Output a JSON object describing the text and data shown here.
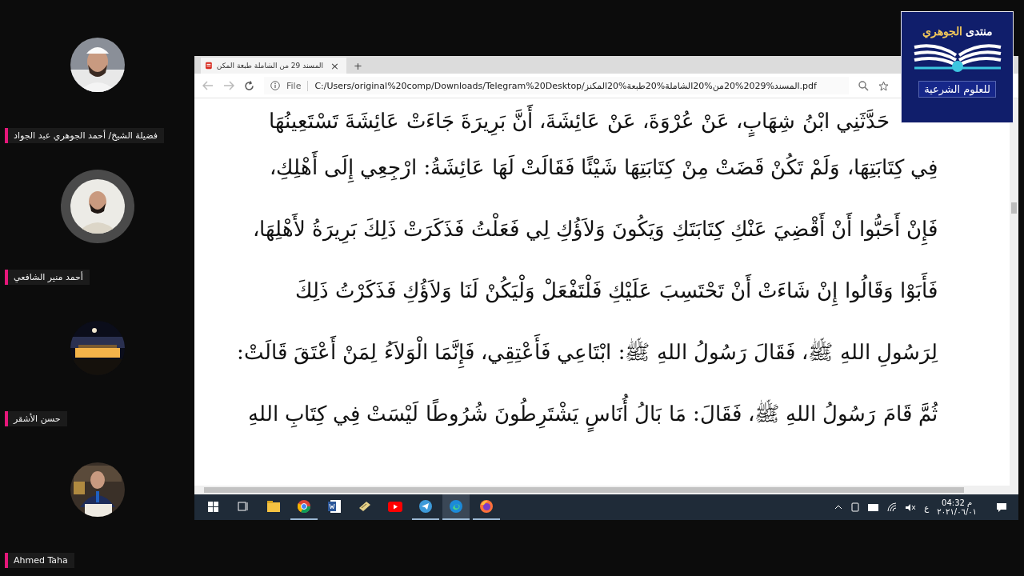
{
  "participants": [
    {
      "name": "فضيلة الشيخ/ أحمد الجوهري عبد الجواد",
      "speaking": false
    },
    {
      "name": "أحمد منير الشافعي",
      "speaking": true
    },
    {
      "name": "حسن الأشقر",
      "speaking": false
    },
    {
      "name": "Ahmed Taha",
      "speaking": false
    }
  ],
  "logo": {
    "title_start": "منتدى",
    "title_name": "الجوهري",
    "subtitle": "للعلوم الشرعية"
  },
  "browser": {
    "tab": {
      "title": "المسند 29 من الشاملة طبعة المكن",
      "close": "×"
    },
    "new_tab": "+",
    "address": {
      "scheme_label": "File",
      "url": "C:/Users/original%20comp/Downloads/Telegram%20Desktop/المسند%2029%20من%20الشاملة%20طبعة%20المكنز.pdf"
    }
  },
  "document": {
    "lines": [
      "حَدَّثَنِي ابْنُ شِهَابٍ، عَنْ عُرْوَةَ، عَنْ عَائِشَةَ، أَنَّ بَرِيرَةَ جَاءَتْ عَائِشَةَ تَسْتَعِينُهَا",
      "فِي كِتَابَتِهَا، وَلَمْ تَكُنْ قَضَتْ مِنْ كِتَابَتِهَا شَيْئًا فَقَالَتْ لَهَا عَائِشَةُ: ارْجِعِي إِلَى أَهْلِكِ،",
      "فَإِنْ أَحَبُّوا أَنْ أَقْضِيَ عَنْكِ كِتَابَتَكِ وَيَكُونَ وَلاَؤُكِ لِي فَعَلْتُ فَذَكَرَتْ ذَلِكَ بَرِيرَةُ لأَهْلِهَا،",
      "فَأَبَوْا وَقَالُوا إِنْ شَاءَتْ أَنْ تَحْتَسِبَ عَلَيْكِ فَلْتَفْعَلْ وَلْيَكُنْ لَنَا وَلاَؤُكِ فَذَكَرْتُ ذَلِكَ",
      "لِرَسُولِ اللهِ ﷺ، فَقَالَ رَسُولُ اللهِ ﷺ: ابْتَاعِي فَأَعْتِقِي، فَإِنَّمَا الْوَلاَءُ لِمَنْ أَعْتَقَ قَالَتْ:",
      "ثُمَّ قَامَ رَسُولُ اللهِ ﷺ، فَقَالَ: مَا بَالُ أُنَاسٍ يَشْتَرِطُونَ شُرُوطًا لَيْسَتْ فِي كِتَابِ اللهِ"
    ]
  },
  "taskbar": {
    "apps": [
      {
        "running": false,
        "focused": false
      },
      {
        "running": true,
        "focused": false
      },
      {
        "running": false,
        "focused": false
      },
      {
        "running": false,
        "focused": false
      },
      {
        "running": false,
        "focused": false
      },
      {
        "running": true,
        "focused": false
      },
      {
        "running": true,
        "focused": true
      },
      {
        "running": true,
        "focused": false
      }
    ],
    "language": "ع",
    "time": "04:32 م",
    "date": "٢٠٢١/٠٦/٠١"
  }
}
